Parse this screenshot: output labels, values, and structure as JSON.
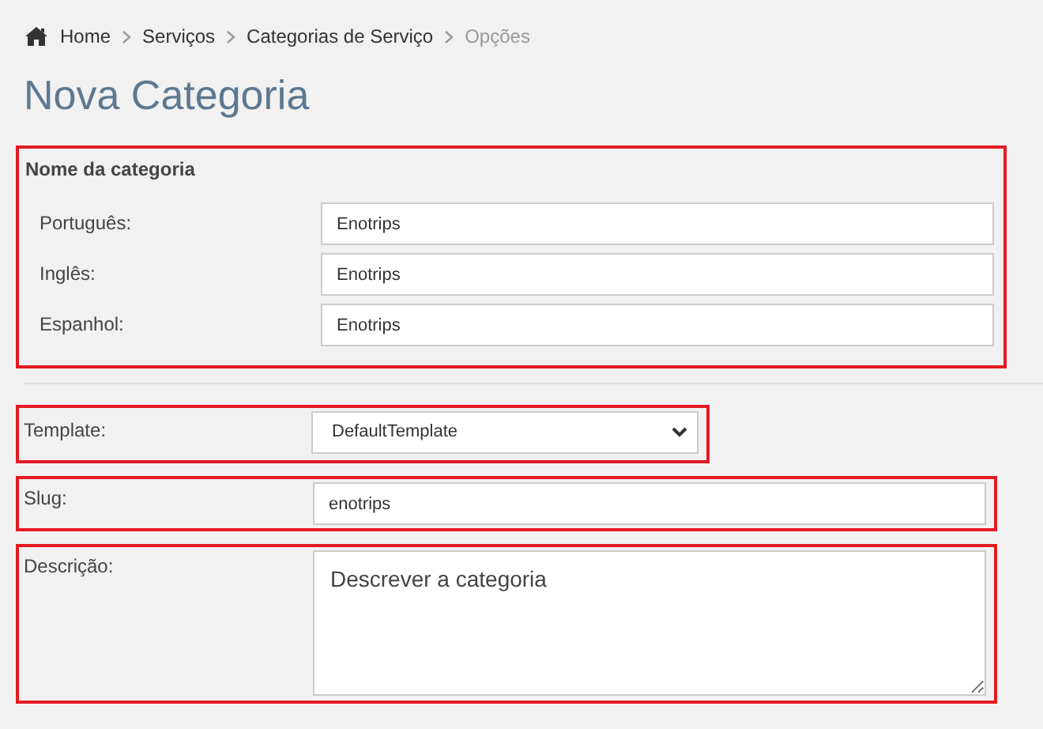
{
  "breadcrumb": [
    {
      "label": "Home",
      "current": false
    },
    {
      "label": "Serviços",
      "current": false
    },
    {
      "label": "Categorias de Serviço",
      "current": false
    },
    {
      "label": "Opções",
      "current": true
    }
  ],
  "title": "Nova Categoria",
  "name_section": {
    "heading": "Nome da categoria",
    "fields": [
      {
        "label": "Português:",
        "value": "Enotrips"
      },
      {
        "label": "Inglês:",
        "value": "Enotrips"
      },
      {
        "label": "Espanhol:",
        "value": "Enotrips"
      }
    ]
  },
  "template": {
    "label": "Template:",
    "value": "DefaultTemplate"
  },
  "slug": {
    "label": "Slug:",
    "value": "enotrips"
  },
  "description": {
    "label": "Descrição:",
    "value": "Descrever a categoria"
  }
}
